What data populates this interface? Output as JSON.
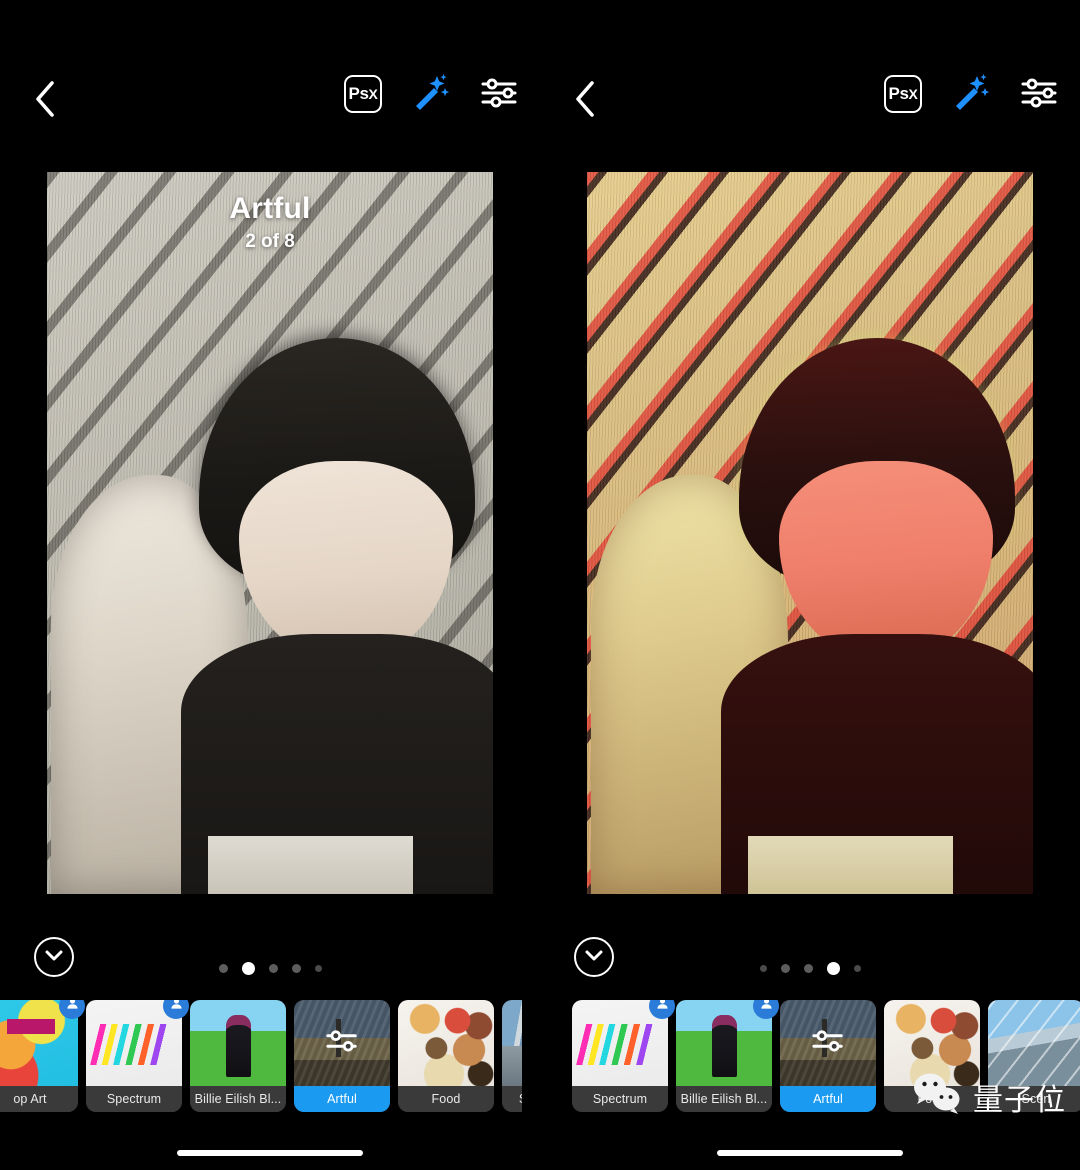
{
  "app": {
    "name": "Photoshop Express",
    "accent_blue": "#1a9af0",
    "magic_wand_blue": "#1e90ff",
    "background": "#000000"
  },
  "panels": [
    {
      "id": "left",
      "topbar": {
        "back_icon": "chevron-left-icon",
        "psx_label_main": "Ps",
        "psx_label_sub": "X",
        "magic_icon": "magic-wand-icon",
        "adjust_icon": "sliders-icon"
      },
      "preview": {
        "overlay_title": "Artful",
        "overlay_count": "2 of 8",
        "filter_style": "grayscale-sketch"
      },
      "collapse_icon": "chevron-down-circle-icon",
      "page_dots": {
        "total": 5,
        "active_index": 1
      },
      "filters": [
        {
          "label": "op Art",
          "art": "tn-popart",
          "selected": false,
          "badge": true,
          "sliders": false,
          "clipped": true
        },
        {
          "label": "Spectrum",
          "art": "tn-spectrum",
          "selected": false,
          "badge": true,
          "sliders": false,
          "clipped": false
        },
        {
          "label": "Billie Eilish Bl...",
          "art": "tn-billie",
          "selected": false,
          "badge": false,
          "sliders": false,
          "clipped": false
        },
        {
          "label": "Artful",
          "art": "tn-artful",
          "selected": true,
          "badge": false,
          "sliders": true,
          "clipped": false
        },
        {
          "label": "Food",
          "art": "tn-food",
          "selected": false,
          "badge": false,
          "sliders": false,
          "clipped": false
        },
        {
          "label": "Scenop Art",
          "art": "tn-scenop",
          "selected": false,
          "badge": true,
          "sliders": false,
          "clipped": false
        }
      ]
    },
    {
      "id": "right",
      "topbar": {
        "back_icon": "chevron-left-icon",
        "psx_label_main": "Ps",
        "psx_label_sub": "X",
        "magic_icon": "magic-wand-icon",
        "adjust_icon": "sliders-icon"
      },
      "preview": {
        "overlay_title": "",
        "overlay_count": "",
        "filter_style": "warm-red-cream"
      },
      "collapse_icon": "chevron-down-circle-icon",
      "page_dots": {
        "total": 5,
        "active_index": 3
      },
      "filters": [
        {
          "label": "Spectrum",
          "art": "tn-spectrum",
          "selected": false,
          "badge": true,
          "sliders": false,
          "clipped": false
        },
        {
          "label": "Billie Eilish Bl...",
          "art": "tn-billie",
          "selected": false,
          "badge": true,
          "sliders": false,
          "clipped": false
        },
        {
          "label": "Artful",
          "art": "tn-artful",
          "selected": true,
          "badge": false,
          "sliders": true,
          "clipped": false
        },
        {
          "label": "Food",
          "art": "tn-food",
          "selected": false,
          "badge": false,
          "sliders": false,
          "clipped": false
        },
        {
          "label": "Scen",
          "art": "tn-scenic",
          "selected": false,
          "badge": false,
          "sliders": false,
          "clipped": true
        }
      ]
    }
  ],
  "watermark": {
    "icon": "wechat-icon",
    "text": "量子位"
  }
}
